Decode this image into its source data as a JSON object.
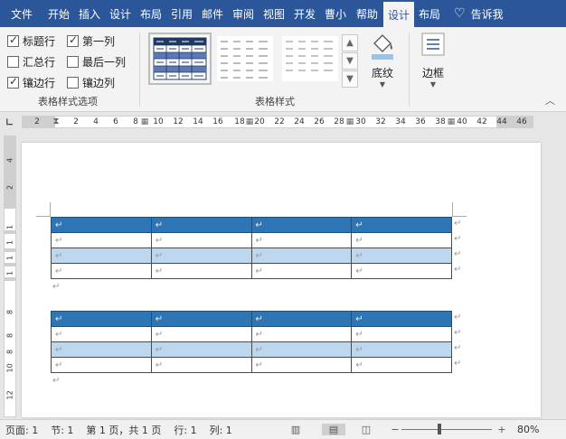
{
  "tabs": [
    "文件",
    "开始",
    "插入",
    "设计",
    "布局",
    "引用",
    "邮件",
    "审阅",
    "视图",
    "开发",
    "曹小",
    "帮助",
    "设计",
    "布局",
    "告诉我"
  ],
  "active_tab_index": 12,
  "ribbon": {
    "options": {
      "label": "表格样式选项",
      "checkboxes": [
        {
          "label": "标题行",
          "checked": true
        },
        {
          "label": "第一列",
          "checked": true
        },
        {
          "label": "汇总行",
          "checked": false
        },
        {
          "label": "最后一列",
          "checked": false
        },
        {
          "label": "镶边行",
          "checked": true
        },
        {
          "label": "镶边列",
          "checked": false
        }
      ]
    },
    "styles": {
      "label": "表格样式"
    },
    "shading": {
      "label": "底纹"
    },
    "borders": {
      "label": "边框"
    }
  },
  "ruler": {
    "h_labels": [
      "2",
      "2",
      "4",
      "6",
      "8",
      "10",
      "12",
      "14",
      "16",
      "18",
      "20",
      "22",
      "24",
      "26",
      "28",
      "30",
      "32",
      "34",
      "36",
      "38",
      "40",
      "42",
      "44",
      "46"
    ],
    "v_labels": [
      "4",
      "2",
      "1",
      "1",
      "1",
      "1",
      "8",
      "8",
      "8",
      "10",
      "12"
    ]
  },
  "document": {
    "mark": "↵",
    "table1_rows": [
      {
        "style": "head",
        "cells": [
          "↵",
          "↵",
          "↵",
          "↵"
        ]
      },
      {
        "style": "plain",
        "cells": [
          "↵",
          "↵",
          "↵",
          "↵"
        ]
      },
      {
        "style": "band",
        "cells": [
          "↵",
          "↵",
          "↵",
          "↵"
        ]
      },
      {
        "style": "plain",
        "cells": [
          "↵",
          "↵",
          "↵",
          "↵"
        ]
      }
    ],
    "table2_rows": [
      {
        "style": "head",
        "cells": [
          "↵",
          "↵",
          "↵",
          "↵"
        ]
      },
      {
        "style": "plain",
        "cells": [
          "↵",
          "↵",
          "↵",
          "↵"
        ]
      },
      {
        "style": "band",
        "cells": [
          "↵",
          "↵",
          "↵",
          "↵"
        ]
      },
      {
        "style": "plain",
        "cells": [
          "↵",
          "↵",
          "↵",
          "↵"
        ]
      }
    ]
  },
  "status": {
    "page": "页面: 1",
    "section": "节: 1",
    "page_of": "第 1 页，共 1 页",
    "row": "行: 1",
    "col": "列: 1",
    "zoom": "80%",
    "zoom_minus": "−",
    "zoom_plus": "+"
  },
  "colors": {
    "ribbon_blue": "#2b579a",
    "header_row": "#2e75b6",
    "band_row": "#bdd7ee"
  }
}
